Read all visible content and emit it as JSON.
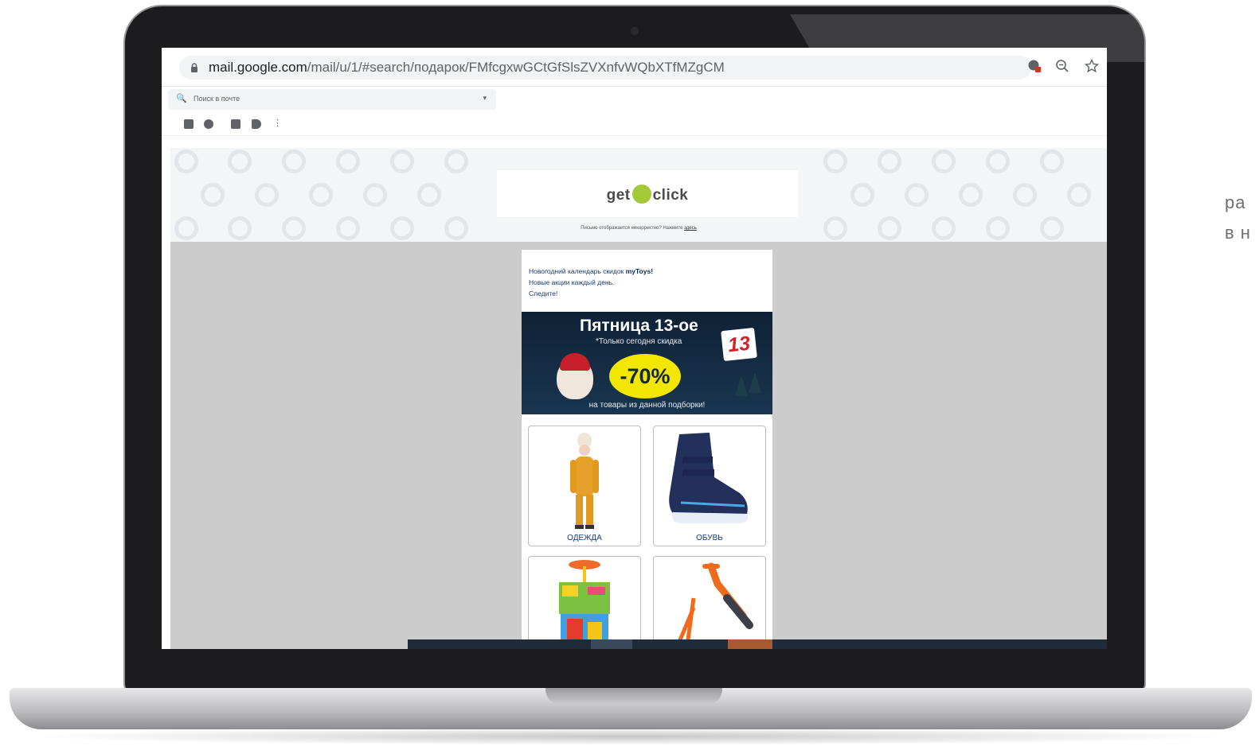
{
  "browser": {
    "url_domain": "mail.google.com",
    "url_path": "/mail/u/1/#search/подарок/FMfcgxwGCtGfSlsZVXnfvWQbXTfMZgCM",
    "icons": [
      "lock-icon",
      "cookie-blocked-icon",
      "zoom-out-icon",
      "star-bookmark-icon"
    ]
  },
  "gmail": {
    "search_placeholder": "Поиск в почте"
  },
  "email": {
    "logo_left": "get",
    "logo_right": "click",
    "notice_text": "Письмо отображается некорректно? Нажмите",
    "notice_link": "здесь",
    "intro_line1_prefix": "Новогодний календарь скидок",
    "intro_brand": "myToys!",
    "intro_line2": "Новые акции каждый день.",
    "intro_line3": "Следите!",
    "banner": {
      "title": "Пятница 13-ое",
      "subtitle": "*Только сегодня скидка",
      "discount": "-70%",
      "calendar_number": "13",
      "bottom": "на товары из данной подборки!"
    },
    "products": [
      {
        "label": "ОДЕЖДА"
      },
      {
        "label": "ОБУВЬ"
      },
      {
        "label": ""
      },
      {
        "label": ""
      }
    ]
  },
  "side_text": [
    "ра",
    "в н"
  ]
}
